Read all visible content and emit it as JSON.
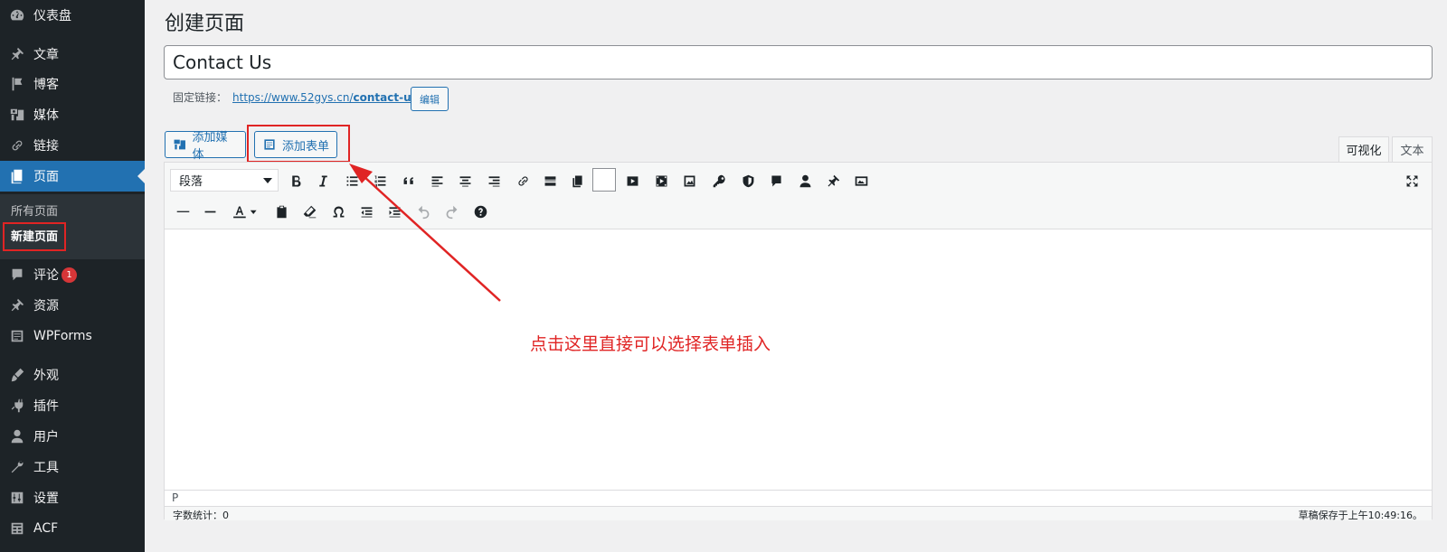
{
  "sidebar": {
    "items": [
      {
        "label": "仪表盘",
        "icon": "dashboard-icon"
      },
      {
        "label": "文章",
        "icon": "pin-icon"
      },
      {
        "label": "博客",
        "icon": "flag-icon"
      },
      {
        "label": "媒体",
        "icon": "media-icon"
      },
      {
        "label": "链接",
        "icon": "link-icon"
      },
      {
        "label": "页面",
        "icon": "page-icon",
        "active": true
      },
      {
        "label": "评论",
        "icon": "comment-icon",
        "badge": "1"
      },
      {
        "label": "资源",
        "icon": "pin-icon"
      },
      {
        "label": "WPForms",
        "icon": "wpforms-icon"
      },
      {
        "label": "外观",
        "icon": "brush-icon"
      },
      {
        "label": "插件",
        "icon": "plugin-icon"
      },
      {
        "label": "用户",
        "icon": "user-icon"
      },
      {
        "label": "工具",
        "icon": "wrench-icon"
      },
      {
        "label": "设置",
        "icon": "settings-icon"
      },
      {
        "label": "ACF",
        "icon": "acf-icon"
      }
    ],
    "submenu": [
      {
        "label": "所有页面"
      },
      {
        "label": "新建页面",
        "current": true
      }
    ]
  },
  "main": {
    "title": "创建页面",
    "post_title": "Contact Us",
    "permalink": {
      "label": "固定链接：",
      "base": "https://www.52gys.cn/",
      "slug": "contact-us",
      "edit_label": "编辑"
    },
    "buttons": {
      "add_media": "添加媒体",
      "add_form": "添加表单"
    },
    "tabs": {
      "visual": "可视化",
      "text": "文本"
    },
    "editor": {
      "format": "段落",
      "path": "P",
      "word_count": "字数统计：0",
      "autosave": "草稿保存于上午10:49:16。"
    },
    "annotation": "点击这里直接可以选择表单插入"
  },
  "colors": {
    "sidebar_bg": "#1d2327",
    "accent": "#2271b1",
    "highlight": "#e02424"
  }
}
